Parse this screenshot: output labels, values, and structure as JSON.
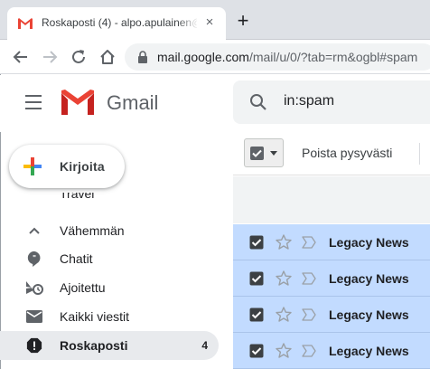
{
  "browser": {
    "tab_title": "Roskaposti (4) - alpo.apulainen@",
    "tab_close": "×",
    "new_tab": "+",
    "url_host": "mail.google.com",
    "url_path": "/mail/u/0/?tab=rm&ogbl#spam"
  },
  "header": {
    "app_name": "Gmail",
    "search_value": "in:spam"
  },
  "sidebar": {
    "compose_label": "Kirjoita",
    "partial_item_label": "Travel",
    "items": [
      {
        "label": "Vähemmän",
        "icon": "chevron-up-icon"
      },
      {
        "label": "Chatit",
        "icon": "chat-icon"
      },
      {
        "label": "Ajoitettu",
        "icon": "scheduled-icon"
      },
      {
        "label": "Kaikki viestit",
        "icon": "all-mail-icon"
      },
      {
        "label": "Roskaposti",
        "icon": "spam-icon",
        "count": "4",
        "active": true
      }
    ]
  },
  "toolbar": {
    "delete_forever_label": "Poista pysyvästi"
  },
  "messages": [
    {
      "sender": "Legacy News",
      "selected": true
    },
    {
      "sender": "Legacy News",
      "selected": true
    },
    {
      "sender": "Legacy News",
      "selected": true
    },
    {
      "sender": "Legacy News",
      "selected": true
    }
  ],
  "colors": {
    "selected_row": "#c2dbff",
    "active_nav": "#e8eaed",
    "gmail_red": "#ea4335",
    "google_blue": "#4285f4",
    "google_green": "#34a853",
    "google_yellow": "#fbbc04"
  }
}
